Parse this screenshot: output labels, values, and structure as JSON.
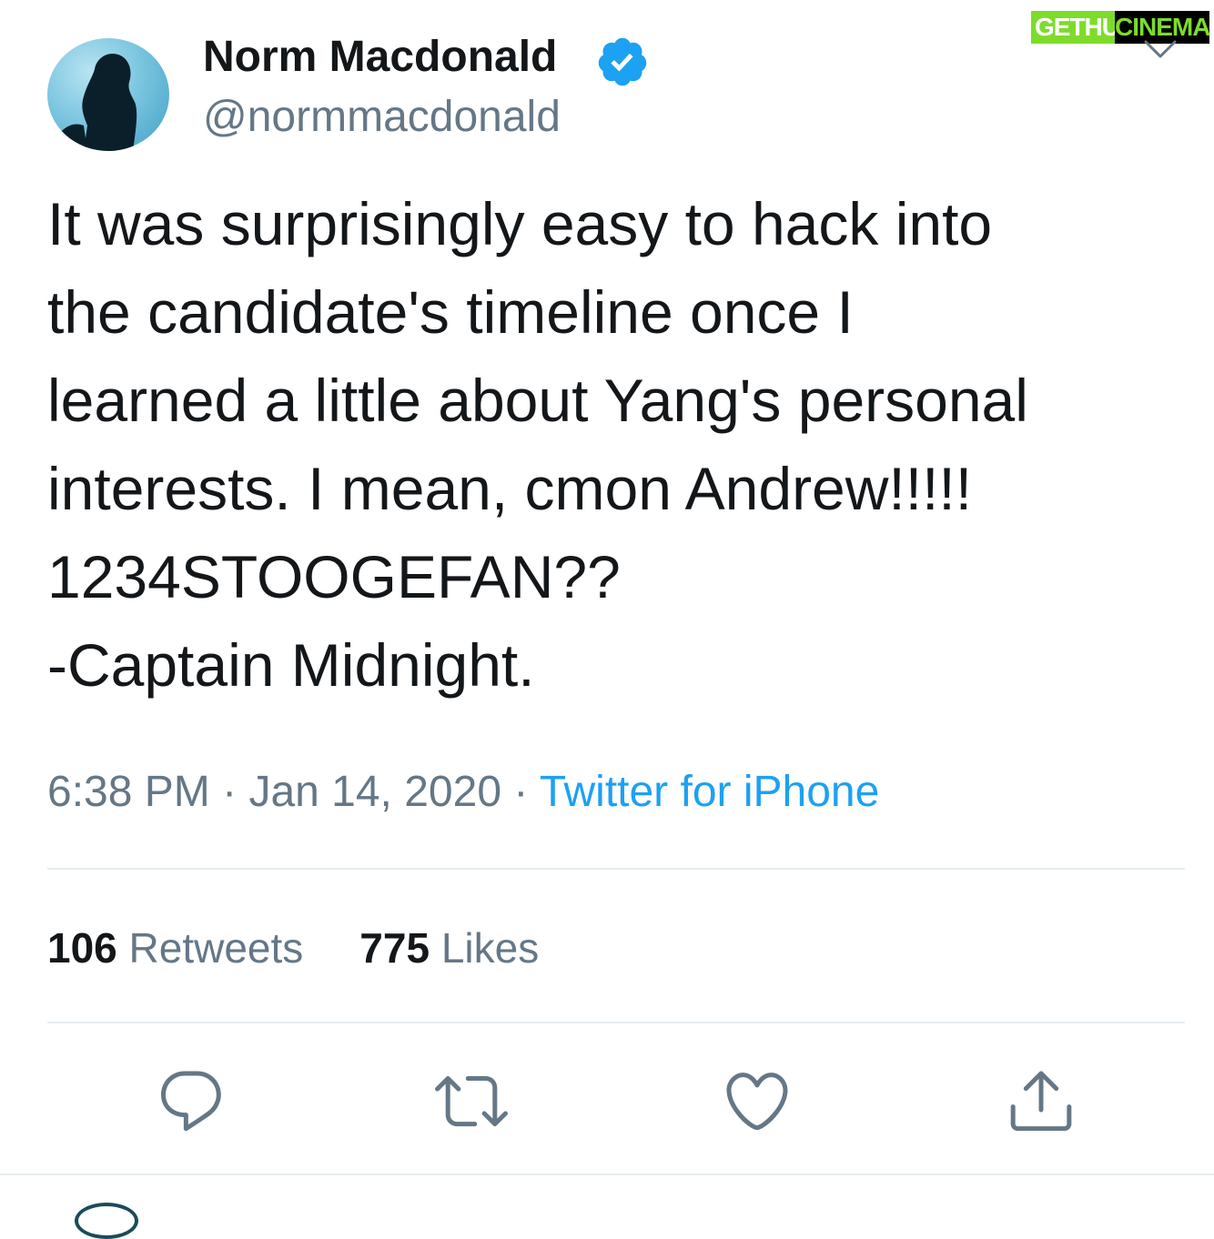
{
  "tweet": {
    "author_name": "Norm Macdonald",
    "handle": "@normmacdonald",
    "text_lines": [
      "It was surprisingly easy to hack into",
      "the candidate's timeline once I",
      "learned a little about Yang's personal",
      "interests. I mean, cmon Andrew!!!!!",
      "1234STOOGEFAN??",
      "-Captain Midnight."
    ],
    "time": "6:38 PM",
    "separator": "·",
    "date": "Jan 14, 2020",
    "source": "Twitter for iPhone"
  },
  "stats": {
    "retweets_count": "106",
    "retweets_label": "Retweets",
    "likes_count": "775",
    "likes_label": "Likes"
  },
  "watermark": {
    "left_text": "GETHU",
    "right_text": "CINEMA"
  },
  "colors": {
    "accent": "#1da1f2",
    "secondary_text": "#657786",
    "primary_text": "#14171a",
    "divider": "#e6ecf0"
  },
  "icons": [
    "verified-badge-icon",
    "reply-icon",
    "retweet-icon",
    "like-icon",
    "share-icon",
    "chevron-down-icon"
  ]
}
